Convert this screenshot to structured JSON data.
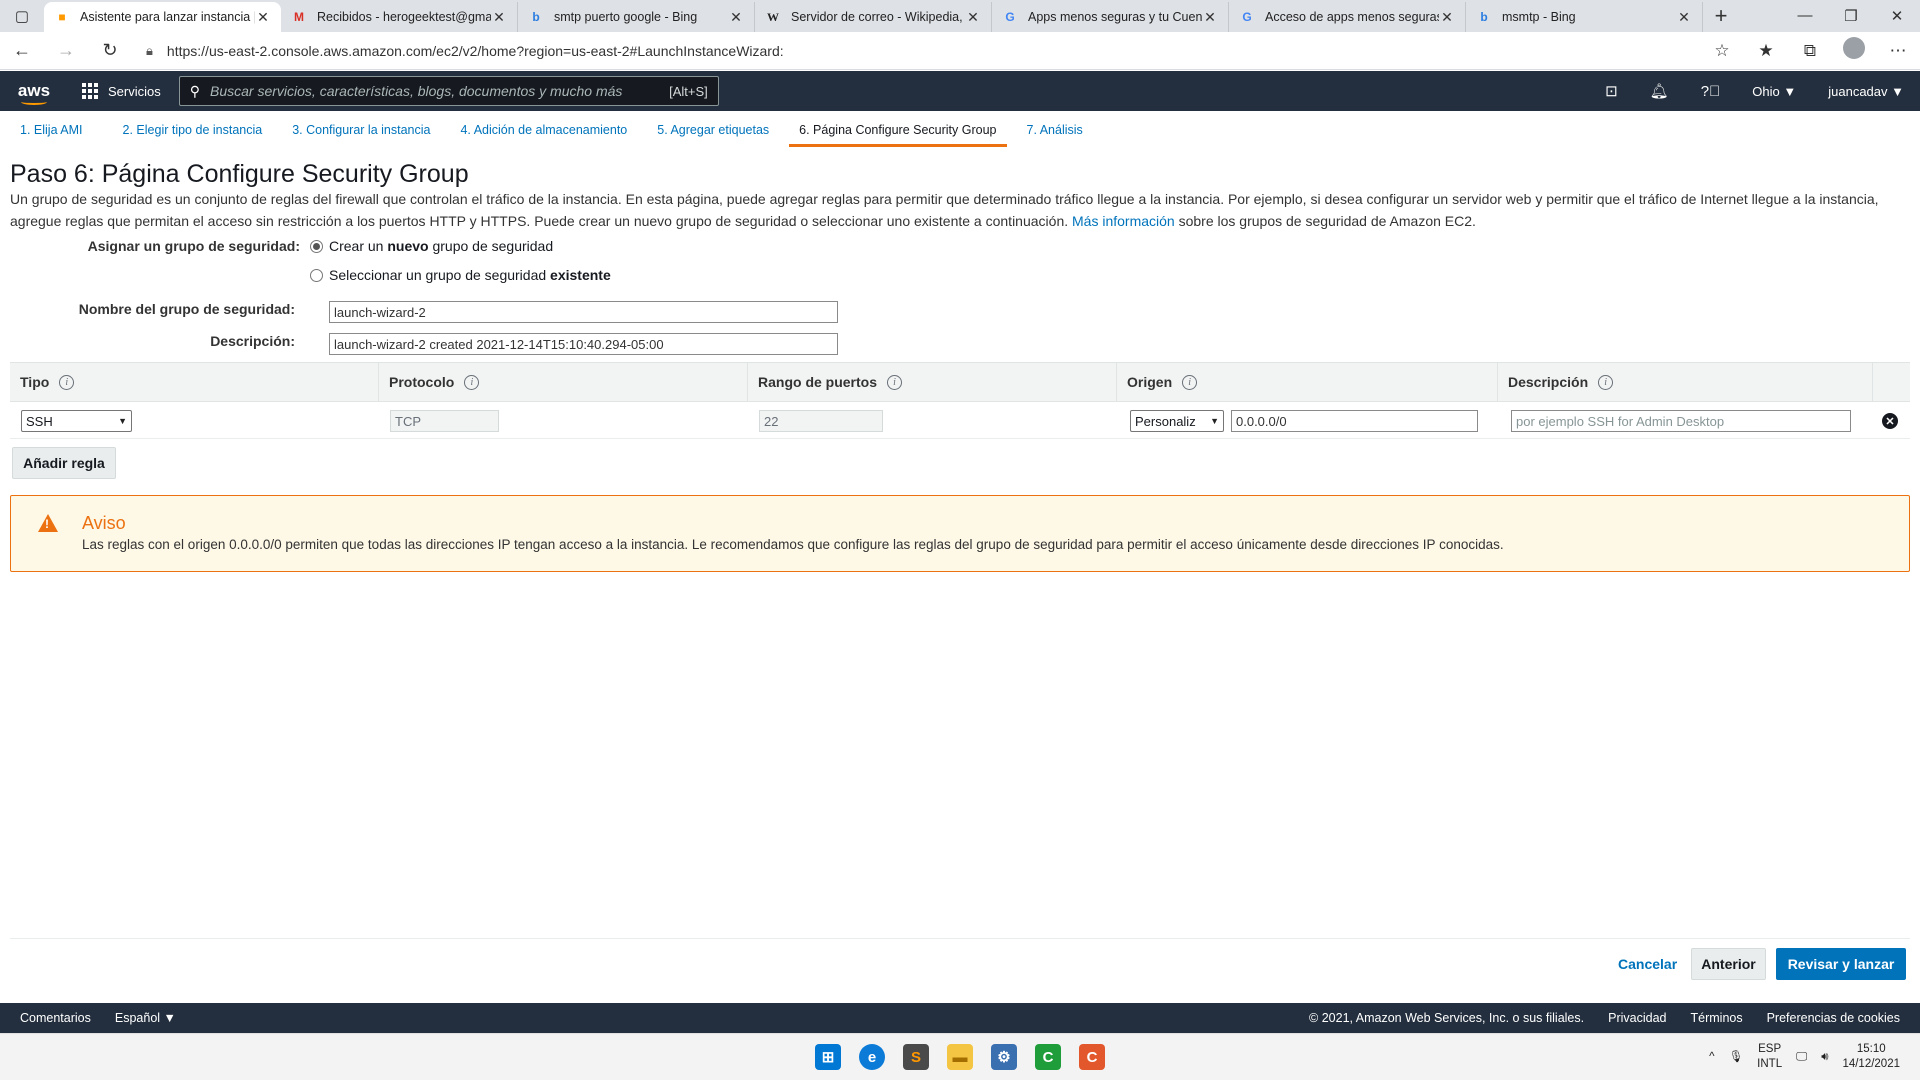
{
  "browser": {
    "tabs": [
      {
        "title": "Asistente para lanzar instancia | E",
        "icon": "aws-box-icon",
        "active": true
      },
      {
        "title": "Recibidos - herogeektest@gmai",
        "icon": "gmail-icon"
      },
      {
        "title": "smtp puerto google - Bing",
        "icon": "bing-icon"
      },
      {
        "title": "Servidor de correo - Wikipedia, l",
        "icon": "wikipedia-icon"
      },
      {
        "title": "Apps menos seguras y tu Cuent",
        "icon": "google-icon"
      },
      {
        "title": "Acceso de apps menos seguras",
        "icon": "google-icon"
      },
      {
        "title": "msmtp - Bing",
        "icon": "bing-icon"
      }
    ],
    "url": "https://us-east-2.console.aws.amazon.com/ec2/v2/home?region=us-east-2#LaunchInstanceWizard:"
  },
  "aws_header": {
    "logo": "aws",
    "services": "Servicios",
    "search_placeholder": "Buscar servicios, características, blogs, documentos y mucho más",
    "search_shortcut": "[Alt+S]",
    "region": "Ohio ▼",
    "user": "juancadav ▼"
  },
  "steps": [
    "1. Elija AMI",
    "2. Elegir tipo de instancia",
    "3. Configurar la instancia",
    "4. Adición de almacenamiento",
    "5. Agregar etiquetas",
    "6. Página Configure Security Group",
    "7. Análisis"
  ],
  "page": {
    "title": "Paso 6: Página Configure Security Group",
    "intro_1": "Un grupo de seguridad es un conjunto de reglas del firewall que controlan el tráfico de la instancia. En esta página, puede agregar reglas para permitir que determinado tráfico llegue a la instancia. Por ejemplo, si desea configurar un servidor web y permitir que el tráfico de Internet llegue a la instancia, agregue reglas que permitan el acceso sin restricción a los puertos HTTP y HTTPS. Puede crear un nuevo grupo de seguridad o seleccionar uno existente a continuación.",
    "intro_link": "Más información",
    "intro_2": "sobre los grupos de seguridad de Amazon EC2."
  },
  "form": {
    "assign_label": "Asignar un grupo de seguridad:",
    "radio_new_pre": "Crear un ",
    "radio_new_bold": "nuevo",
    "radio_new_post": " grupo de seguridad",
    "radio_existing_pre": "Seleccionar un grupo de seguridad ",
    "radio_existing_bold": "existente",
    "name_label": "Nombre del grupo de seguridad:",
    "name_value": "launch-wizard-2",
    "desc_label": "Descripción:",
    "desc_value": "launch-wizard-2 created 2021-12-14T15:10:40.294-05:00"
  },
  "rules_table": {
    "headers": [
      "Tipo",
      "Protocolo",
      "Rango de puertos",
      "Origen",
      "Descripción"
    ],
    "rows": [
      {
        "type": "SSH",
        "protocol": "TCP",
        "port_range": "22",
        "source_mode": "Personaliz",
        "source_cidr": "0.0.0.0/0",
        "description_placeholder": "por ejemplo SSH for Admin Desktop"
      }
    ],
    "add_rule": "Añadir regla"
  },
  "warning": {
    "title": "Aviso",
    "body": "Las reglas con el origen 0.0.0.0/0 permiten que todas las direcciones IP tengan acceso a la instancia. Le recomendamos que configure las reglas del grupo de seguridad para permitir el acceso únicamente desde direcciones IP conocidas."
  },
  "actions": {
    "cancel": "Cancelar",
    "previous": "Anterior",
    "review": "Revisar y lanzar"
  },
  "footer": {
    "feedback": "Comentarios",
    "language": "Español ▼",
    "copyright": "© 2021, Amazon Web Services, Inc. o sus filiales.",
    "privacy": "Privacidad",
    "terms": "Términos",
    "cookies": "Preferencias de cookies"
  },
  "taskbar": {
    "lang_1": "ESP",
    "lang_2": "INTL",
    "time": "15:10",
    "date": "14/12/2021"
  },
  "colors": {
    "aws_header": "#232f3e",
    "link": "#0073bb",
    "accent_orange": "#ec7211",
    "warning_bg": "#fef8e6"
  }
}
